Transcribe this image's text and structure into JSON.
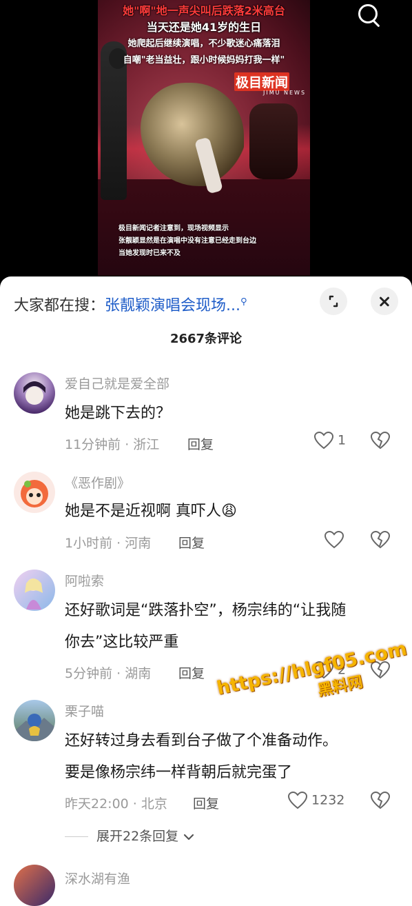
{
  "video": {
    "caption_lines": [
      "她\"啊\"地一声尖叫后跌落2米高台",
      "当天还是她41岁的生日",
      "她爬起后继续演唱，不少歌迷心痛落泪",
      "自嘲\"老当益壮，跟小时候妈妈打我一样\""
    ],
    "logo_text": "极目新闻",
    "logo_sub": "JIMU NEWS",
    "subtitles": [
      "极目新闻记者注意到，现场视频显示",
      "张靓颖显然是在演唱中没有注意已经走到台边",
      "当她发现时已来不及"
    ]
  },
  "sheet": {
    "hot_search_label": "大家都在搜：",
    "hot_search_query": "张靓颖演唱会现场...",
    "comment_count": "2667条评论"
  },
  "comments": [
    {
      "username": "爱自己就是爱全部",
      "lines": [
        "她是跳下去的？"
      ],
      "time_location": "11分钟前 · 浙江",
      "reply_label": "回复",
      "likes": "1"
    },
    {
      "username": "《恶作剧》",
      "lines": [
        "她是不是近视啊 真吓人😩"
      ],
      "time_location": "1小时前 · 河南",
      "reply_label": "回复",
      "likes": ""
    },
    {
      "username": "阿啦索",
      "lines": [
        "还好歌词是“跌落扑空”，杨宗纬的“让我随",
        "你去”这比较严重"
      ],
      "time_location": "5分钟前 · 湖南",
      "reply_label": "回复",
      "likes": "2"
    },
    {
      "username": "栗子喵",
      "lines": [
        "还好转过身去看到台子做了个准备动作。",
        "要是像杨宗纬一样背朝后就完蛋了"
      ],
      "time_location": "昨天22:00 · 北京",
      "reply_label": "回复",
      "likes": "1232"
    }
  ],
  "expand_replies": "展开22条回复",
  "next_comment_username": "深水湖有渔",
  "watermark": {
    "line1": "https://hlgf05.com",
    "line2": "黑料网"
  },
  "icons": {
    "search": "search-icon",
    "expand": "expand-icon",
    "close": "close-icon",
    "like": "heart-icon",
    "dislike": "broken-heart-icon",
    "chevron": "chevron-down-icon"
  },
  "colors": {
    "query_link": "#1e5cc8",
    "caption_red": "#ff3b3b",
    "watermark": "#f5b400"
  }
}
